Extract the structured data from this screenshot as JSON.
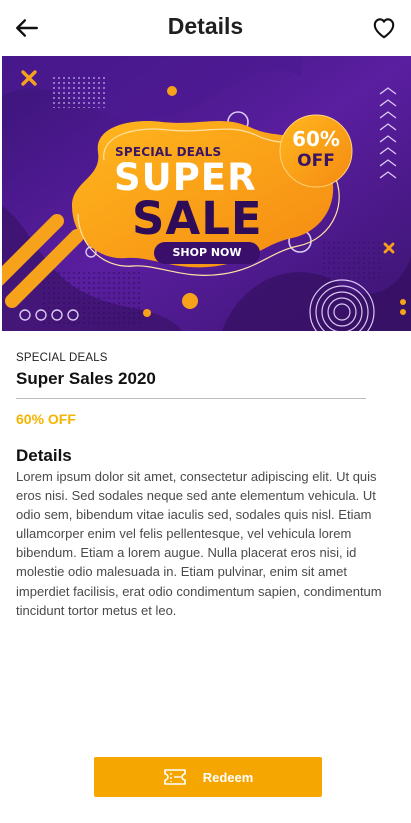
{
  "header": {
    "title": "Details",
    "back_icon": "arrow-left-icon",
    "favorite_icon": "heart-outline-icon"
  },
  "banner": {
    "kicker": "SPECIAL DEALS",
    "headline_1": "SUPER",
    "headline_2": "SALE",
    "cta": "SHOP NOW",
    "badge_percent": "60%",
    "badge_off": "OFF",
    "colors": {
      "background": "#4a1a8c",
      "accent": "#f7a21b",
      "dark": "#2f0c57"
    }
  },
  "deal": {
    "category": "SPECIAL DEALS",
    "name": "Super Sales 2020",
    "discount": "60% OFF"
  },
  "details": {
    "title": "Details",
    "text": "Lorem ipsum dolor sit amet, consectetur adipiscing elit. Ut quis eros nisi. Sed sodales neque sed ante elementum vehicula. Ut odio sem, bibendum vitae iaculis sed, sodales quis nisl. Etiam ullamcorper enim vel felis pellentesque, vel vehicula lorem bibendum. Etiam a lorem augue. Nulla placerat eros nisi, id molestie odio malesuada in. Etiam pulvinar, enim sit amet imperdiet facilisis, erat odio condimentum sapien, condimentum tincidunt tortor metus et leo."
  },
  "action": {
    "redeem_label": "Redeem",
    "icon": "ticket-icon",
    "color": "#f6a600"
  }
}
